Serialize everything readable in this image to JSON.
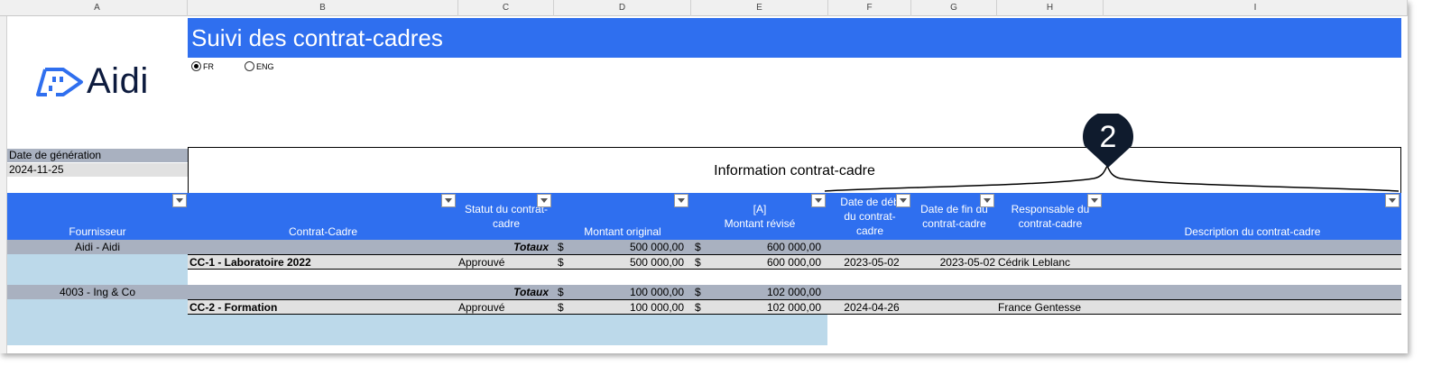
{
  "columns": [
    "A",
    "B",
    "C",
    "D",
    "E",
    "F",
    "G",
    "H",
    "I"
  ],
  "title": "Suivi des contrat-cadres",
  "language_options": [
    {
      "label": "FR",
      "selected": true
    },
    {
      "label": "ENG",
      "selected": false
    }
  ],
  "logo": {
    "text": "Aidi",
    "icon": "aidi-logo-icon",
    "color": "#2f6fef"
  },
  "generation": {
    "label": "Date de génération",
    "value": "2024-11-25"
  },
  "section_title": "Information contrat-cadre",
  "callout_number": "2",
  "headers": [
    "Fournisseur",
    "Contrat-Cadre",
    "Statut du contrat-cadre",
    "Montant original",
    "[A] Montant révisé",
    "Date de début du contrat-cadre",
    "Date de fin du contrat-cadre",
    "Responsable du contrat-cadre",
    "Description du contrat-cadre"
  ],
  "header_lines": {
    "statut": [
      "Statut du contrat-",
      "cadre"
    ],
    "revise": [
      "[A]",
      "Montant révisé"
    ],
    "debut": [
      "Date de déb",
      "du contrat-",
      "cadre"
    ],
    "fin": [
      "Date de fin du",
      "contrat-cadre"
    ],
    "responsable": [
      "Responsable du",
      "contrat-cadre"
    ]
  },
  "currency": "$",
  "groups": [
    {
      "supplier": "Aidi - Aidi",
      "totals_label": "Totaux",
      "total_original": "500 000,00",
      "total_revised": "600 000,00",
      "contract": {
        "name": "CC-1 - Laboratoire 2022",
        "status": "Approuvé",
        "original": "500 000,00",
        "revised": "600 000,00",
        "start": "2023-05-02",
        "end": "2023-05-02",
        "manager": "Cédrik Leblanc",
        "description": ""
      }
    },
    {
      "supplier": "4003 - Ing & Co",
      "totals_label": "Totaux",
      "total_original": "100 000,00",
      "total_revised": "102 000,00",
      "contract": {
        "name": "CC-2 - Formation",
        "status": "Approuvé",
        "original": "100 000,00",
        "revised": "102 000,00",
        "start": "2024-04-26",
        "end": "",
        "manager": "France Gentesse",
        "description": ""
      }
    }
  ],
  "colors": {
    "header_blue": "#2f6fef",
    "total_gray": "#a9b1c0",
    "row_gray": "#e1e1e1",
    "light_blue": "#bcd9ea",
    "callout": "#0f1b2d"
  }
}
